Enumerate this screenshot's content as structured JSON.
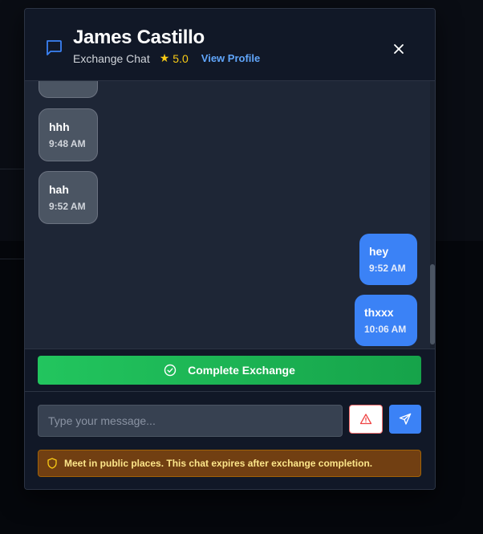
{
  "header": {
    "name": "James Castillo",
    "subtitle": "Exchange Chat",
    "rating": "5.0",
    "view_profile": "View Profile",
    "close_label": "×"
  },
  "messages": [
    {
      "direction": "incoming",
      "text": "hhh",
      "time": "9:48 AM"
    },
    {
      "direction": "incoming",
      "text": "hah",
      "time": "9:52 AM"
    },
    {
      "direction": "outgoing",
      "text": "hey",
      "time": "9:52 AM"
    },
    {
      "direction": "outgoing",
      "text": "thxxx",
      "time": "10:06 AM"
    }
  ],
  "complete_button": {
    "label": "Complete Exchange"
  },
  "composer": {
    "placeholder": "Type your message..."
  },
  "notice": {
    "text": "Meet in public places. This chat expires after exchange completion."
  },
  "colors": {
    "accent": "#3b82f6",
    "success": "#22c55e",
    "warning_bg": "#713f12",
    "warning_text": "#fde68a",
    "danger": "#ef4444",
    "star": "#facc15"
  },
  "icons": [
    "chat-bubble-icon",
    "star-icon",
    "close-icon",
    "check-circle-icon",
    "alert-triangle-icon",
    "send-icon",
    "shield-icon"
  ]
}
